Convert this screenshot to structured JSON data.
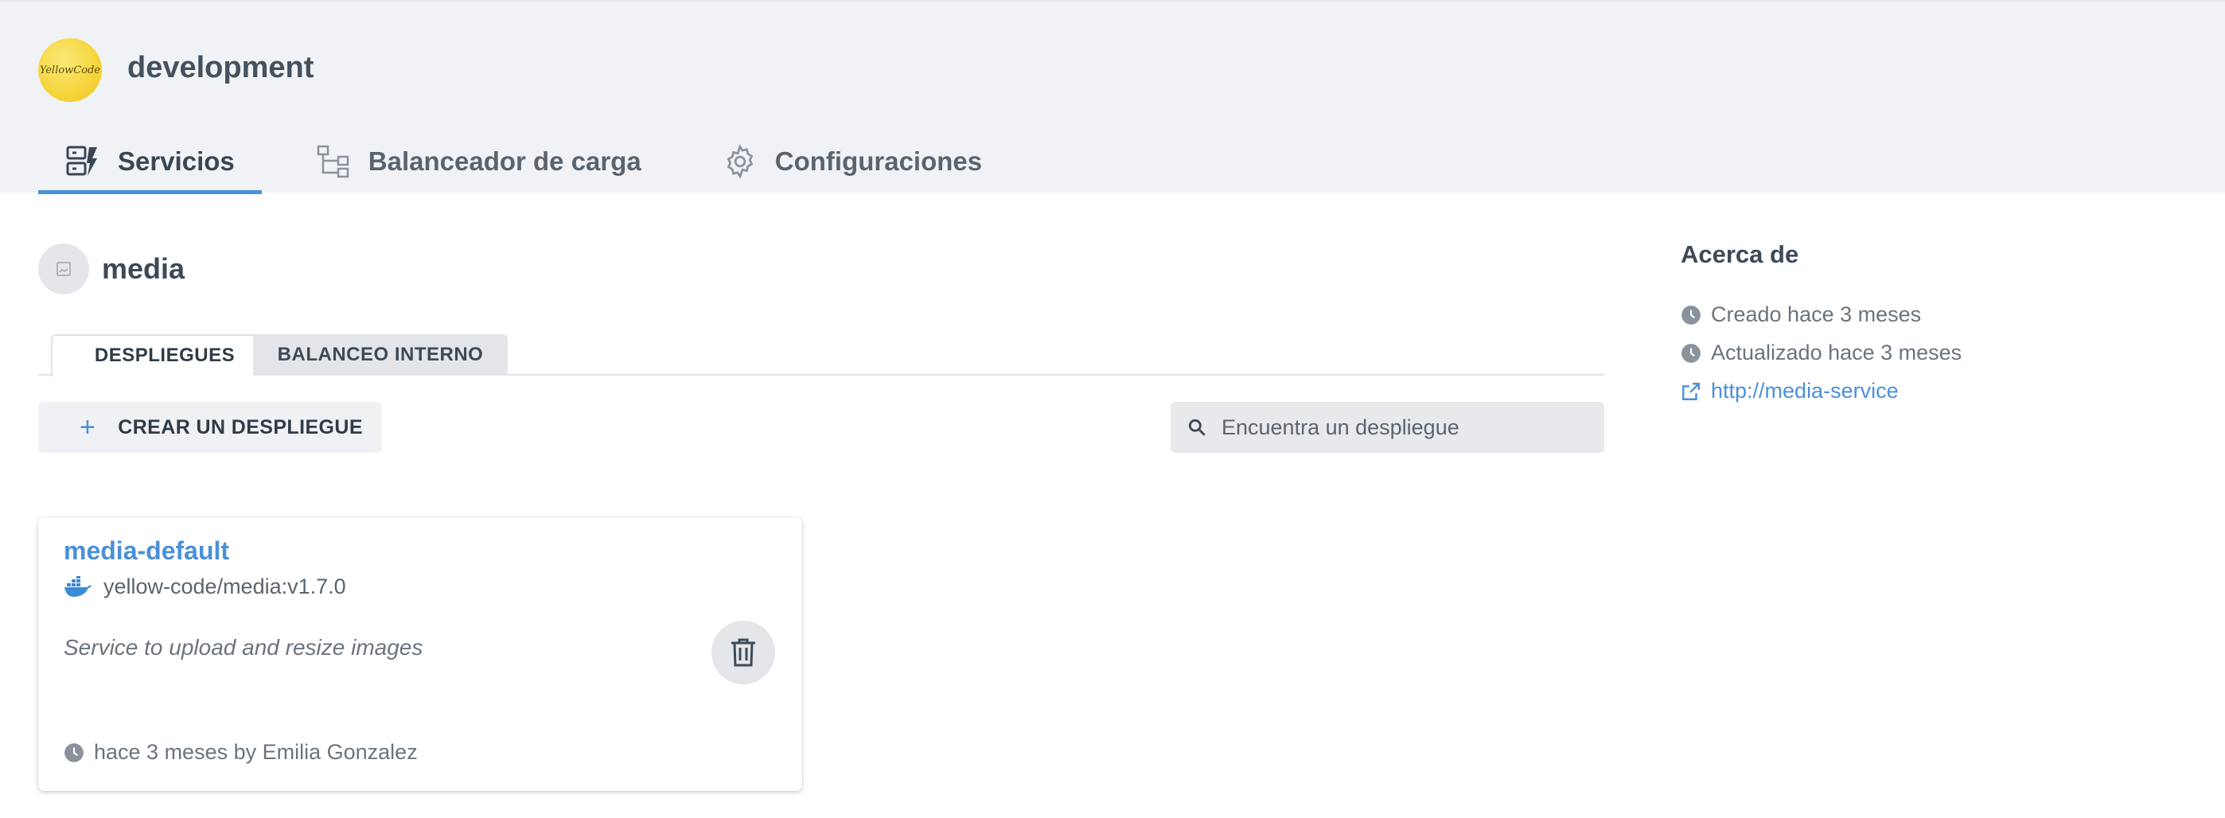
{
  "header": {
    "logo_text": "YellowCode",
    "env_title": "development",
    "tabs": [
      {
        "label": "Servicios",
        "icon": "services-icon",
        "active": true
      },
      {
        "label": "Balanceador de carga",
        "icon": "load-balancer-icon",
        "active": false
      },
      {
        "label": "Configuraciones",
        "icon": "gear-icon",
        "active": false
      }
    ]
  },
  "service": {
    "name": "media",
    "subtabs": [
      "DESPLIEGUES",
      "BALANCEO INTERNO"
    ],
    "create_button": "CREAR UN DESPLIEGUE",
    "search_placeholder": "Encuentra un despliegue"
  },
  "deployments": [
    {
      "name": "media-default",
      "image": "yellow-code/media:v1.7.0",
      "description": "Service to upload and resize images",
      "meta": "hace 3 meses by Emilia Gonzalez"
    }
  ],
  "about": {
    "title": "Acerca de",
    "created": "Creado hace 3 meses",
    "updated": "Actualizado hace 3 meses",
    "link": "http://media-service"
  },
  "colors": {
    "accent": "#4a90d9",
    "header_bg": "#f1f2f5",
    "logo": "#f5d43a"
  }
}
